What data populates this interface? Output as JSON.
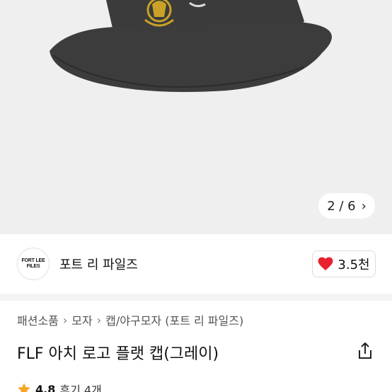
{
  "gallery": {
    "counter": "2 / 6"
  },
  "brand": {
    "logo_line1": "FORT LEE",
    "logo_line2": "FILES",
    "name": "포트 리 파일즈",
    "like_count": "3.5천"
  },
  "breadcrumb": [
    "패션소품",
    "모자",
    "캡/야구모자 (포트 리 파일즈)"
  ],
  "product": {
    "title": "FLF 아치 로고 플랫 캡(그레이)"
  },
  "rating": {
    "score": "4.8",
    "reviews": "후기 4개"
  },
  "colors": {
    "hero_bg": "#efefef",
    "cap_gray": "#3a3a3a",
    "emblem_gold": "#c9a227",
    "heart_red": "#e8212e",
    "star": "#f5a623"
  }
}
